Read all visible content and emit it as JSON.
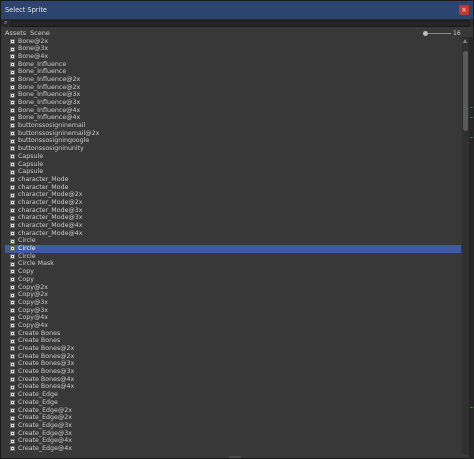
{
  "window": {
    "title": "Select Sprite",
    "close_glyph": "×"
  },
  "search": {
    "value": "",
    "placeholder": ""
  },
  "tabs": [
    {
      "label": "Assets"
    },
    {
      "label": "Scene"
    }
  ],
  "zoom": {
    "value": "16",
    "slider_fraction": 0.0
  },
  "list": {
    "selected_index": 27,
    "items": [
      "Bone@2x",
      "Bone@3x",
      "Bone@4x",
      "Bone_Influence",
      "Bone_Influence",
      "Bone_Influence@2x",
      "Bone_Influence@2x",
      "Bone_Influence@3x",
      "Bone_Influence@3x",
      "Bone_Influence@4x",
      "Bone_Influence@4x",
      "buttonssosigninemail",
      "buttonssosigninemail@2x",
      "buttonssosigningoogle",
      "buttonssosigninunity",
      "Capsule",
      "Capsule",
      "Capsule",
      "character_Mode",
      "character_Mode",
      "character_Mode@2x",
      "character_Mode@2x",
      "character_Mode@3x",
      "character_Mode@3x",
      "character_Mode@4x",
      "character_Mode@4x",
      "Circle",
      "Circle",
      "Circle",
      "Circle Mask",
      "Copy",
      "Copy",
      "Copy@2x",
      "Copy@2x",
      "Copy@3x",
      "Copy@3x",
      "Copy@4x",
      "Copy@4x",
      "Create Bones",
      "Create Bones",
      "Create Bones@2x",
      "Create Bones@2x",
      "Create Bones@3x",
      "Create Bones@3x",
      "Create Bones@4x",
      "Create Bones@4x",
      "Create_Edge",
      "Create_Edge",
      "Create_Edge@2x",
      "Create_Edge@2x",
      "Create_Edge@3x",
      "Create_Edge@3x",
      "Create_Edge@4x",
      "Create_Edge@4x"
    ]
  },
  "colors": {
    "titlebar": "#2d4470",
    "selection": "#3f5aa6",
    "background": "#383838",
    "close_button": "#c0392b"
  },
  "icons": {
    "search": "search-icon",
    "close": "close-icon",
    "sprite": "sprite-icon"
  }
}
